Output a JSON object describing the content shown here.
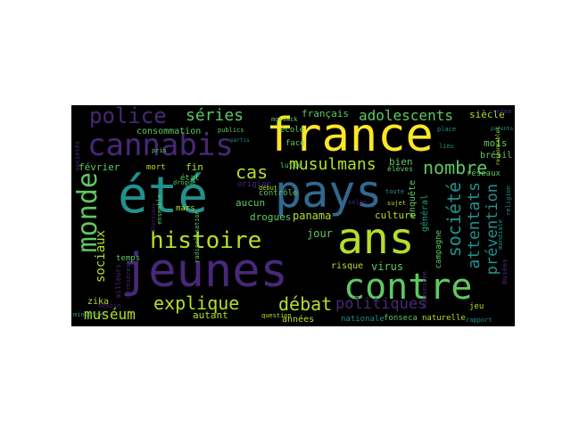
{
  "palette": {
    "background": "#000000",
    "yellow": "#fde725",
    "lime": "#b5de2b",
    "green": "#5ec962",
    "teal": "#21918c",
    "cyan": "#1fa187",
    "blue": "#3b528b",
    "indigo": "#31688e",
    "purple": "#440154",
    "violet": "#482878"
  },
  "words": {
    "france": "france",
    "pays": "pays",
    "ete": "été",
    "ans": "ans",
    "jeunes": "jeunes",
    "cannabis": "cannabis",
    "contre": "contre",
    "monde": "monde",
    "histoire": "histoire",
    "police": "police",
    "series": "séries",
    "adolescents": "adolescents",
    "siecle": "siècle",
    "nombre": "nombre",
    "societe": "société",
    "attentats": "attentats",
    "prevention": "prévention",
    "musulmans": "musulmans",
    "cas": "cas",
    "explique": "explique",
    "debat": "débat",
    "politiques": "politiques",
    "museum": "muséum",
    "sociaux": "sociaux",
    "francais": "français",
    "consommation": "consommation",
    "fevrier": "février",
    "fin": "fin",
    "mort": "mort",
    "etat": "état",
    "aucun": "aucun",
    "drogues": "drogues",
    "panama": "panama",
    "jour": "jour",
    "culture": "culture",
    "bien": "bien",
    "mois": "mois",
    "bresil": "brésil",
    "reseaux": "réseaux",
    "enquete": "enquête",
    "general": "général",
    "campagne": "campagne",
    "virus": "virus",
    "risque": "risque",
    "annees": "années",
    "nationale": "nationale",
    "fonseca": "fonseca",
    "naturelle": "naturelle",
    "jeu": "jeu",
    "zika": "zika",
    "autant": "autant",
    "temps": "temps",
    "mars": "mars",
    "controle": "contrôle",
    "lutte": "lutte",
    "face": "face",
    "ecole": "école",
    "eleves": "élèves",
    "mossack": "mossack",
    "debut": "début",
    "question": "question",
    "ministre": "ministre",
    "publics": "publics",
    "parents": "parents",
    "drogue": "drogue",
    "origine": "origine",
    "sujet": "sujet",
    "ensemble": "ensemble",
    "ailleurs": "ailleurs",
    "dernieres": "dernières",
    "societes": "sociétés",
    "radicalisation": "radicalisation",
    "communisme": "communisme",
    "place": "place",
    "cinema": "cinéma",
    "lieu": "lieu",
    "pris": "pris",
    "partis": "partis",
    "selon": "selon",
    "toute": "toute",
    "musees": "musées",
    "besoin": "besoin",
    "rapport": "rapport",
    "religion": "religion",
    "elections": "élections",
    "mondiale": "mondiale",
    "responsables": "responsables"
  }
}
